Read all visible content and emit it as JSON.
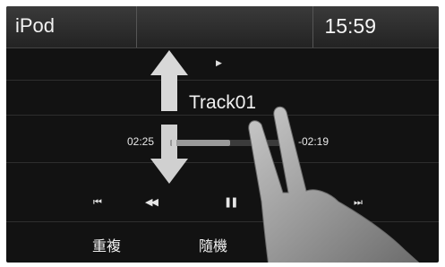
{
  "header": {
    "title": "iPod",
    "time": "15:59"
  },
  "now_playing": {
    "play_indicator": "▶",
    "track": "Track01",
    "elapsed": "02:25",
    "remaining": "-02:19",
    "progress": 0.51
  },
  "controls": {
    "prev_track": "⏮",
    "rewind": "◀◀",
    "pause": "❚❚",
    "next_track": "⏭"
  },
  "buttons": {
    "repeat": "重複",
    "shuffle": "隨機"
  },
  "colors": {
    "screen_bg": "#121212",
    "header_bg": "#2c2c2c",
    "text": "#f0f0f0"
  }
}
